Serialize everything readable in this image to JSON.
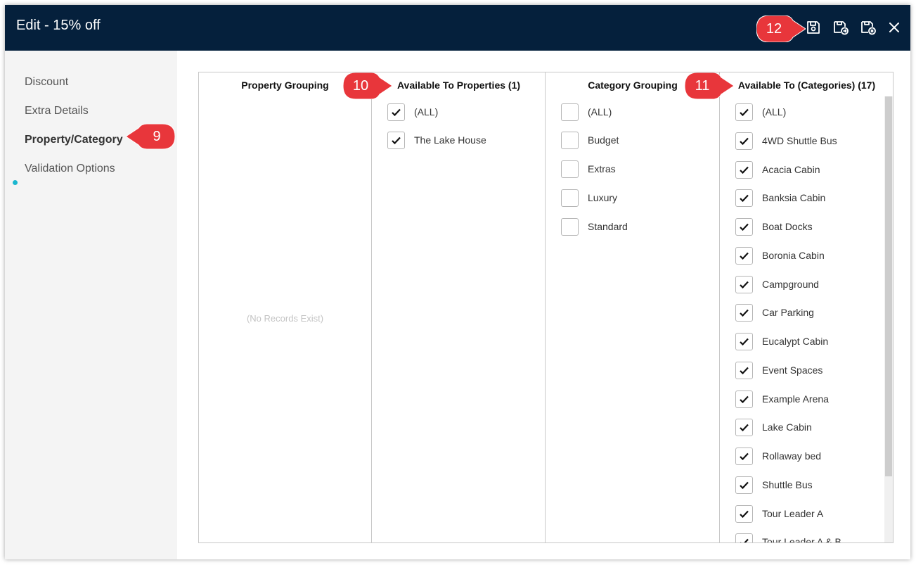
{
  "window": {
    "title": "Edit - 15% off"
  },
  "toolbar": {
    "icons": [
      "save-icon",
      "save-and-copy-icon",
      "save-and-close-icon",
      "close-icon"
    ]
  },
  "sidebar": {
    "items": [
      {
        "label": "Discount",
        "active": false
      },
      {
        "label": "Extra Details",
        "active": false
      },
      {
        "label": "Property/Category",
        "active": true
      },
      {
        "label": "Validation Options",
        "active": false
      }
    ]
  },
  "columns": {
    "property_grouping": {
      "header": "Property Grouping",
      "empty_text": "(No Records Exist)"
    },
    "available_properties": {
      "header": "Available To Properties (1)",
      "items": [
        {
          "label": "(ALL)",
          "checked": true
        },
        {
          "label": "The Lake House",
          "checked": true
        }
      ]
    },
    "category_grouping": {
      "header": "Category Grouping",
      "items": [
        {
          "label": "(ALL)",
          "checked": false
        },
        {
          "label": "Budget",
          "checked": false
        },
        {
          "label": "Extras",
          "checked": false
        },
        {
          "label": "Luxury",
          "checked": false
        },
        {
          "label": "Standard",
          "checked": false
        }
      ]
    },
    "available_categories": {
      "header": "Available To (Categories) (17)",
      "items": [
        {
          "label": "(ALL)",
          "checked": true
        },
        {
          "label": "4WD Shuttle Bus",
          "checked": true
        },
        {
          "label": "Acacia Cabin",
          "checked": true
        },
        {
          "label": "Banksia Cabin",
          "checked": true
        },
        {
          "label": "Boat Docks",
          "checked": true
        },
        {
          "label": "Boronia Cabin",
          "checked": true
        },
        {
          "label": "Campground",
          "checked": true
        },
        {
          "label": "Car Parking",
          "checked": true
        },
        {
          "label": "Eucalypt Cabin",
          "checked": true
        },
        {
          "label": "Event Spaces",
          "checked": true
        },
        {
          "label": "Example Arena",
          "checked": true
        },
        {
          "label": "Lake Cabin",
          "checked": true
        },
        {
          "label": "Rollaway bed",
          "checked": true
        },
        {
          "label": "Shuttle Bus",
          "checked": true
        },
        {
          "label": "Tour Leader A",
          "checked": true
        },
        {
          "label": "Tour Leader A & B",
          "checked": true
        }
      ]
    }
  },
  "callouts": [
    "9",
    "10",
    "11",
    "12"
  ],
  "colors": {
    "titlebar": "#05203c",
    "callout": "#e8363b",
    "active_dot": "#1ab7cf",
    "sidebar_bg": "#f4f4f4"
  }
}
